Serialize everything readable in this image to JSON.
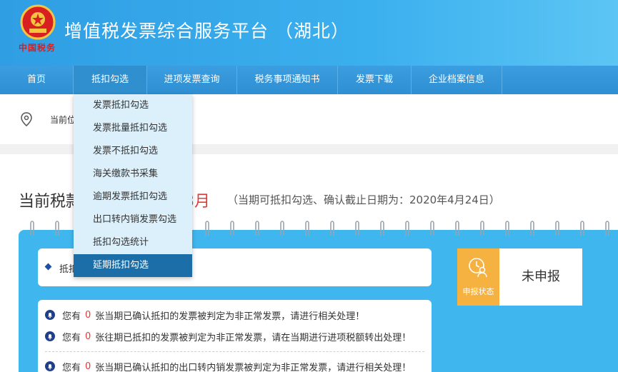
{
  "header": {
    "title": "增值税发票综合服务平台 （湖北）",
    "seal_text": "中国税务"
  },
  "nav": {
    "items": [
      {
        "label": "首页"
      },
      {
        "label": "抵扣勾选"
      },
      {
        "label": "进项发票查询"
      },
      {
        "label": "税务事项通知书"
      },
      {
        "label": "发票下载"
      },
      {
        "label": "企业档案信息"
      }
    ]
  },
  "location": {
    "label": "当前位"
  },
  "dropdown": {
    "items": [
      {
        "label": "发票抵扣勾选"
      },
      {
        "label": "发票批量抵扣勾选"
      },
      {
        "label": "发票不抵扣勾选"
      },
      {
        "label": "海关缴款书采集"
      },
      {
        "label": "逾期发票抵扣勾选"
      },
      {
        "label": "出口转内销发票勾选"
      },
      {
        "label": "抵扣勾选统计"
      },
      {
        "label": "延期抵扣勾选",
        "active": true
      }
    ]
  },
  "period": {
    "title_prefix": "当前税款",
    "month": "3月",
    "note": "（当期可抵扣勾选、确认截止日期为：2020年4月24日）"
  },
  "notice": {
    "text": "抵扣"
  },
  "warnings": [
    {
      "prefix": "您有",
      "count": "0",
      "suffix": "张当期已确认抵扣的发票被判定为非正常发票，请进行相关处理！"
    },
    {
      "prefix": "您有",
      "count": "0",
      "suffix": "张往期已抵扣的发票被判定为非正常发票，请在当期进行进项税额转出处理！"
    },
    {
      "prefix": "您有",
      "count": "0",
      "suffix": "张当期已确认抵扣的出口转内销发票被判定为非正常发票，请进行相关处理！"
    }
  ],
  "status": {
    "label": "申报状态",
    "value": "未申报"
  },
  "colors": {
    "header_blue": "#2f9ee3",
    "nav_blue": "#2e8fd3",
    "board_blue": "#40b6ee",
    "dropdown_bg": "#dcf0fb",
    "dropdown_active": "#1b6ea8",
    "alert_red": "#e53a3a",
    "status_orange": "#f6b240"
  },
  "icons": {
    "emblem": "national-tax-emblem-icon",
    "location": "map-pin-icon",
    "status": "user-clock-icon",
    "warning": "bell-icon",
    "notice": "diamond-bullet-icon"
  }
}
